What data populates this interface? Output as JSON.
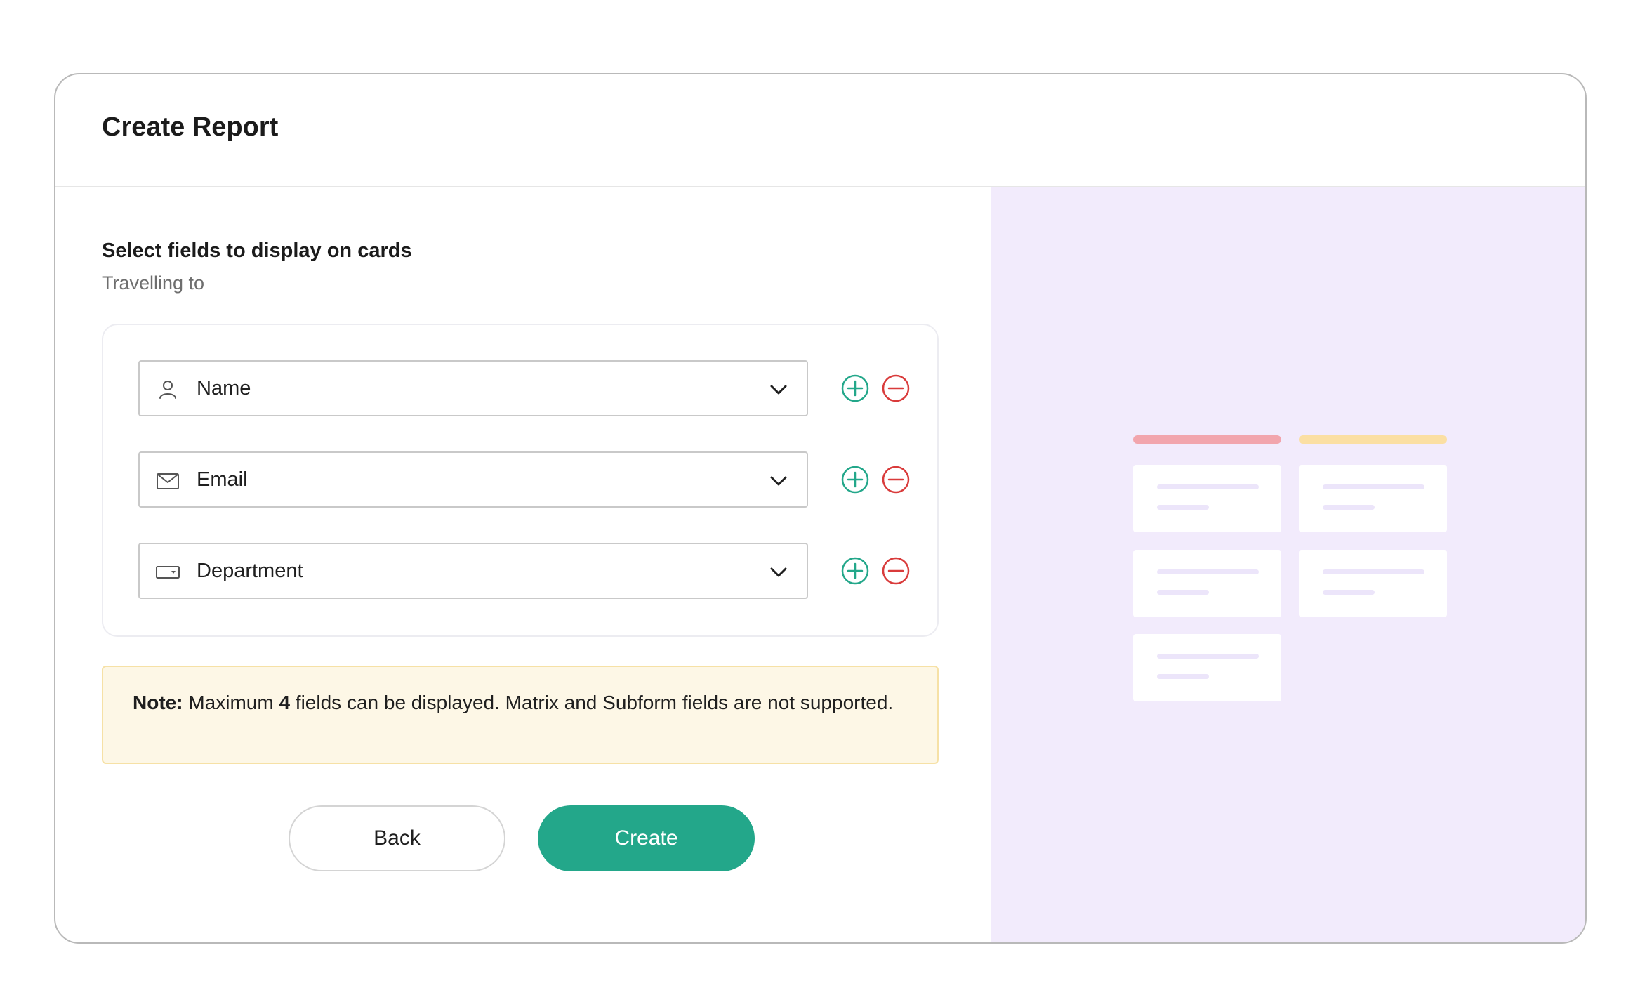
{
  "dialog": {
    "title": "Create Report"
  },
  "section": {
    "heading": "Select fields to display on cards",
    "subheading": "Travelling to"
  },
  "fields": [
    {
      "label": "Name",
      "icon": "person-icon"
    },
    {
      "label": "Email",
      "icon": "mail-icon"
    },
    {
      "label": "Department",
      "icon": "dropdown-field-icon"
    }
  ],
  "note": {
    "prefix": "Note:",
    "text_before": " Maximum ",
    "max_count": "4",
    "text_after": " fields can be displayed. Matrix and Subform fields are not supported."
  },
  "actions": {
    "back_label": "Back",
    "create_label": "Create"
  },
  "colors": {
    "accent": "#23a78a",
    "remove": "#d93b3b",
    "preview_bg": "#f2ebfc",
    "note_bg": "#fdf7e6",
    "column_1": "#f2a5ad",
    "column_2": "#fbdfa3"
  },
  "preview": {
    "columns": [
      {
        "color": "#f2a5ad",
        "cards": 3
      },
      {
        "color": "#fbdfa3",
        "cards": 2
      }
    ]
  }
}
